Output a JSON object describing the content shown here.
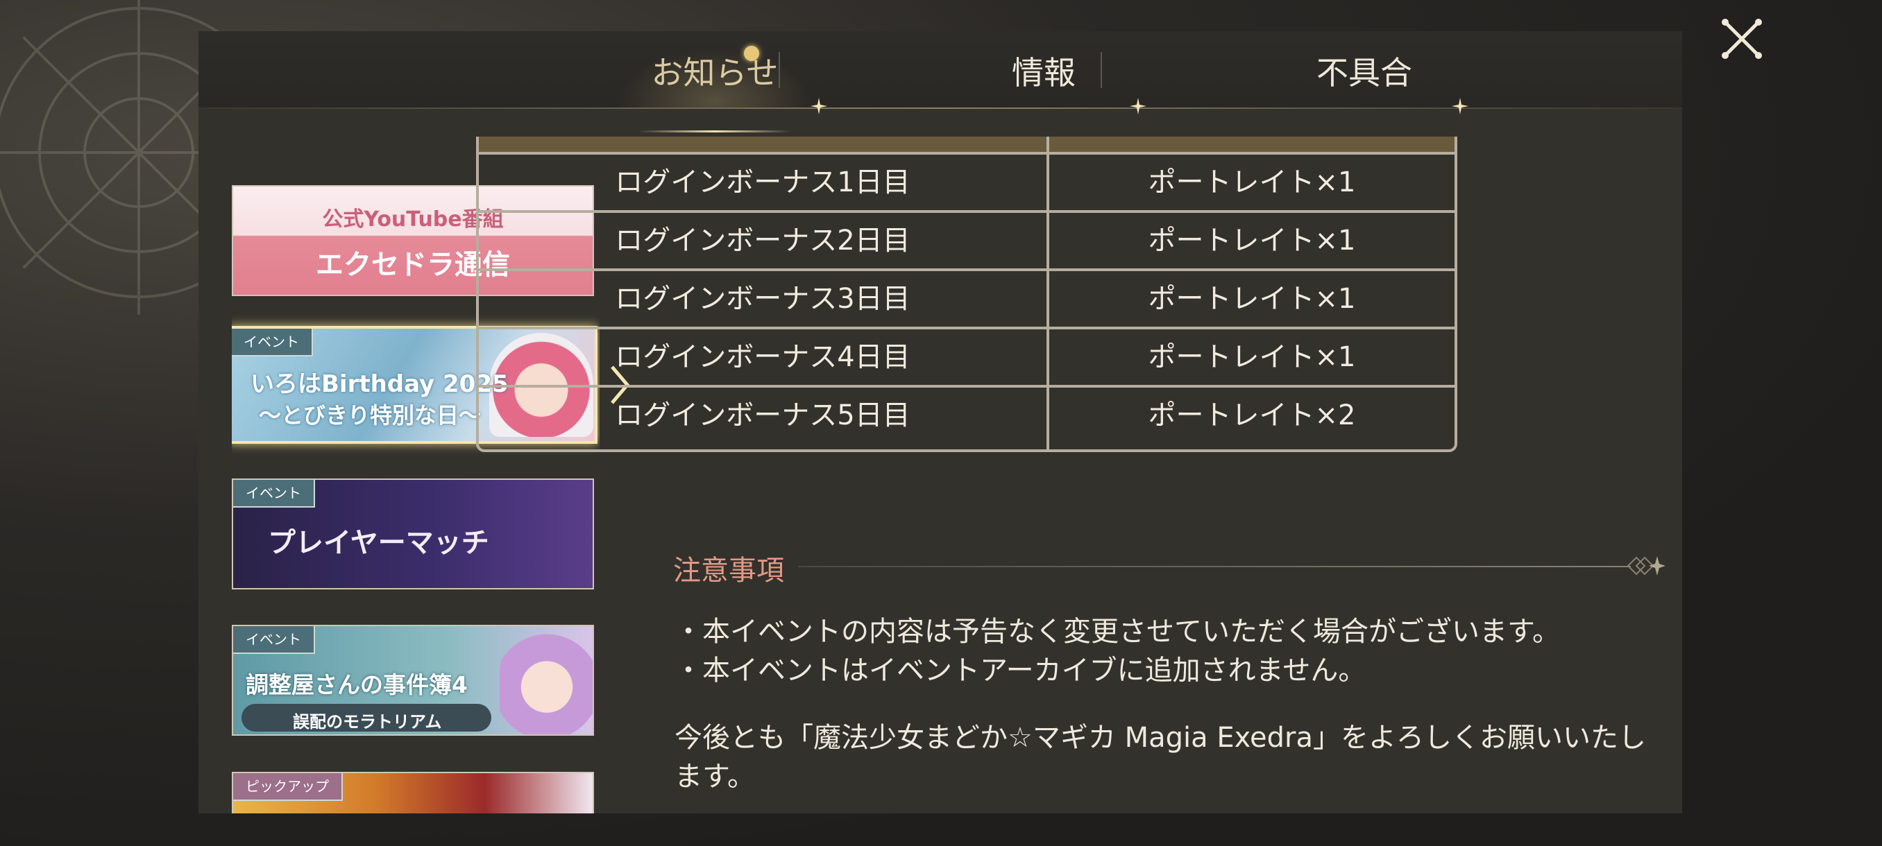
{
  "tabs": [
    {
      "label": "お知らせ",
      "active": true
    },
    {
      "label": "情報",
      "active": false
    },
    {
      "label": "不具合",
      "active": false
    }
  ],
  "banners": [
    {
      "title_line1": "公式YouTube番組",
      "title_line2": "エクセドラ通信"
    },
    {
      "tag": "イベント",
      "title_line1": "いろはBirthday 2025",
      "title_line2": "〜とびきり特別な日〜",
      "selected": true
    },
    {
      "tag": "イベント",
      "title_line1": "プレイヤーマッチ"
    },
    {
      "tag": "イベント",
      "title_line1": "調整屋さんの事件簿4",
      "title_line2": "誤配のモラトリアム"
    },
    {
      "tag": "ピックアップ"
    }
  ],
  "reward_table": {
    "rows": [
      {
        "condition": "ログインボーナス1日目",
        "reward": "ポートレイト×1"
      },
      {
        "condition": "ログインボーナス2日目",
        "reward": "ポートレイト×1"
      },
      {
        "condition": "ログインボーナス3日目",
        "reward": "ポートレイト×1"
      },
      {
        "condition": "ログインボーナス4日目",
        "reward": "ポートレイト×1"
      },
      {
        "condition": "ログインボーナス5日目",
        "reward": "ポートレイト×2"
      }
    ]
  },
  "notes": {
    "title": "注意事項",
    "items": [
      "・本イベントの内容は予告なく変更させていただく場合がございます。",
      "・本イベントはイベントアーカイブに追加されません。"
    ],
    "closing": "今後とも「魔法少女まどか☆マギカ Magia Exedra」をよろしくお願いいたします。"
  },
  "colors": {
    "panel_bg": "#33312c",
    "accent_gold": "#d9c9a2",
    "notes_title": "#e09a86",
    "table_header": "#6a5a3c"
  },
  "icons": {
    "close": "close-x-icon",
    "tab_marker": "sparkle-star-icon",
    "selection": "chevron-right-icon"
  }
}
